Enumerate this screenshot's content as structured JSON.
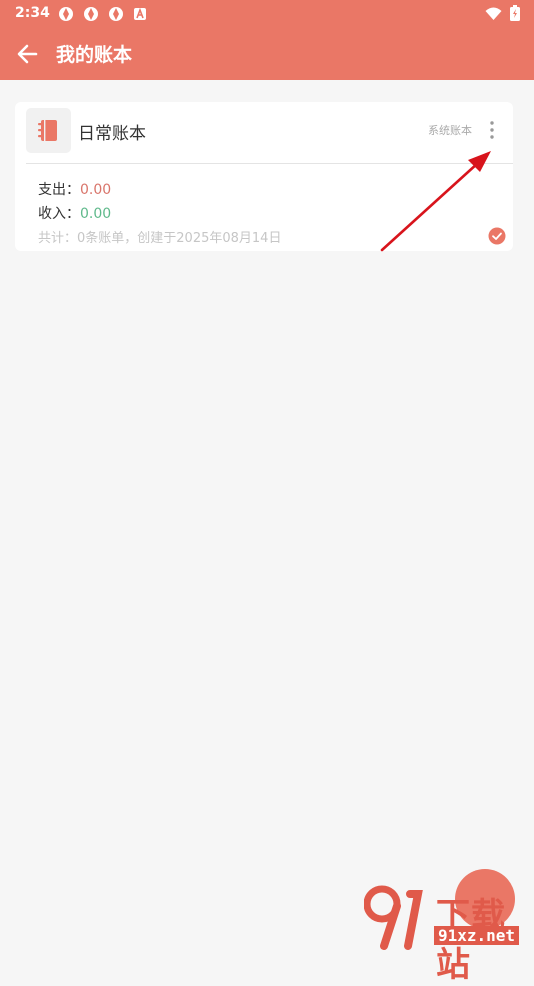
{
  "status_bar": {
    "time": "2:34"
  },
  "app_bar": {
    "title": "我的账本"
  },
  "book": {
    "name": "日常账本",
    "type_label": "系统账本",
    "expense_label": "支出：",
    "expense_value": "0.00",
    "income_label": "收入：",
    "income_value": "0.00",
    "summary": "共计：0条账单，创建于2025年08月14日"
  },
  "watermark": {
    "text": "下载站",
    "url": "91xz.net"
  },
  "colors": {
    "primary": "#ea7766",
    "expense": "#d9756b",
    "income": "#5fb98b",
    "annotation_arrow": "#d8141c"
  }
}
